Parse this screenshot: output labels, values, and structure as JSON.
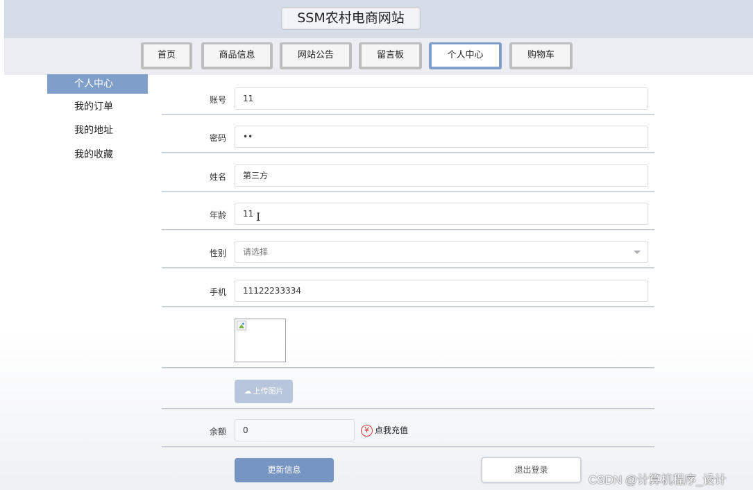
{
  "header": {
    "title": "SSM农村电商网站"
  },
  "nav": {
    "tabs": [
      {
        "label": "首页"
      },
      {
        "label": "商品信息"
      },
      {
        "label": "网站公告"
      },
      {
        "label": "留言板"
      },
      {
        "label": "个人中心"
      },
      {
        "label": "购物车"
      }
    ],
    "active": "个人中心"
  },
  "sidebar": {
    "items": [
      {
        "label": "个人中心"
      },
      {
        "label": "我的订单"
      },
      {
        "label": "我的地址"
      },
      {
        "label": "我的收藏"
      }
    ]
  },
  "form": {
    "account": {
      "label": "账号",
      "value": "11"
    },
    "password": {
      "label": "密码",
      "value": "••"
    },
    "name": {
      "label": "姓名",
      "value": "第三方"
    },
    "age": {
      "label": "年龄",
      "value": "11"
    },
    "gender": {
      "label": "性别",
      "placeholder": "请选择"
    },
    "phone": {
      "label": "手机",
      "value": "11122233334"
    },
    "upload_label": "上传图片",
    "balance": {
      "label": "余额",
      "value": "0"
    },
    "recharge_label": "点我充值",
    "update_label": "更新信息",
    "logout_label": "退出登录"
  },
  "icons": {
    "recharge": "yen-icon",
    "upload": "cloud-upload-icon",
    "select": "chevron-down-icon"
  },
  "colors": {
    "accent": "#7f9fca",
    "primary_button": "#7795c2",
    "header_bg": "#d6dde8"
  },
  "watermark": "CSDN @计算机程序_设计"
}
